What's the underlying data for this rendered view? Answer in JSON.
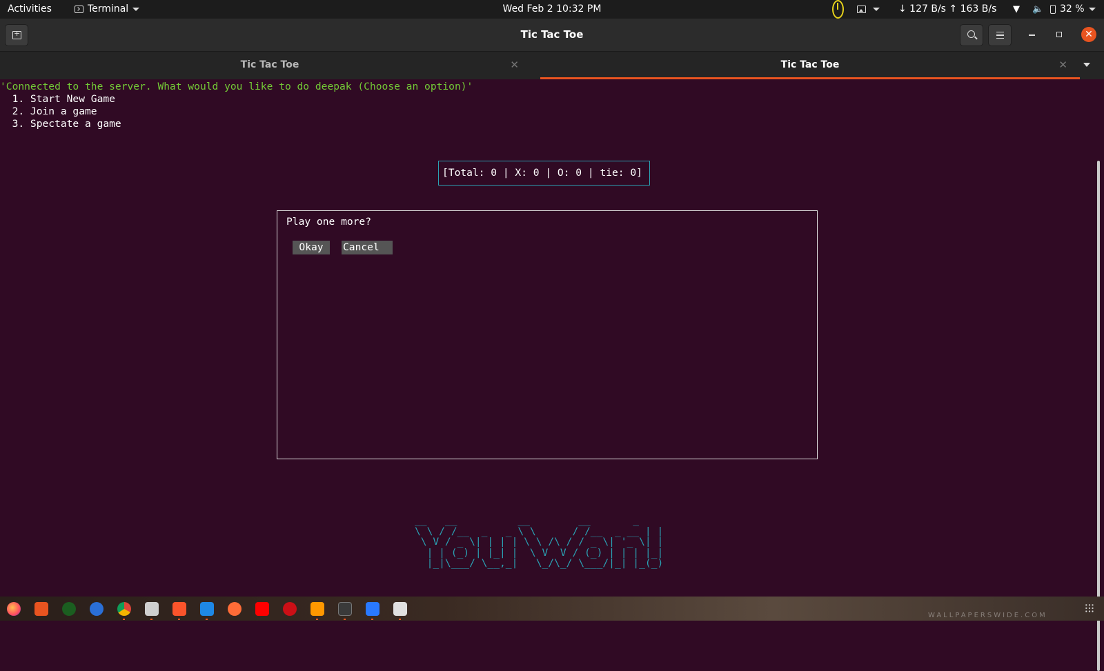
{
  "topbar": {
    "activities": "Activities",
    "app_name": "Terminal",
    "clock": "Wed Feb 2  10:32 PM",
    "network": "↓ 127 B/s ↑ 163 B/s",
    "battery": "32 %"
  },
  "window": {
    "title": "Tic Tac Toe"
  },
  "tabs": [
    {
      "label": "Tic Tac Toe",
      "active": false
    },
    {
      "label": "Tic Tac Toe",
      "active": true
    }
  ],
  "terminal": {
    "status_line": "'Connected to the server. What would you like to do deepak (Choose an option)'",
    "options": [
      "  1. Start New Game",
      "  2. Join a game",
      "  3. Spectate a game"
    ],
    "scoreboard": "[Total: 0 | X: 0 | O: 0 | tie: 0]",
    "dialog": {
      "question": "Play one more?",
      "okay_label": "Okay",
      "cancel_label": "Cancel"
    },
    "ascii_banner": "__   __          __        __       _\n\\ \\ / /__  _   _ \\ \\      / /__  _ __ | |\n \\ V / _ \\| | | | \\ \\ /\\ / / _ \\| '_ \\| |\n  | | (_) | |_| |  \\ V  V / (_) | | | |_|\n  |_|\\___/ \\__,_|   \\_/\\_/ \\___/|_| |_(_)"
  },
  "dock": {
    "apps": [
      "firefox",
      "app-center",
      "gitkraken",
      "thunderbird",
      "chrome",
      "files",
      "brave",
      "vscode",
      "postman",
      "youtube",
      "opera",
      "sublime-text",
      "terminal",
      "writer",
      "text-editor"
    ],
    "watermark": "WALLPAPERSWIDE.COM"
  },
  "colors": {
    "terminal_bg": "#300a24",
    "accent": "#e95420",
    "green_text": "#73c936",
    "cyan": "#2aa1b3"
  }
}
